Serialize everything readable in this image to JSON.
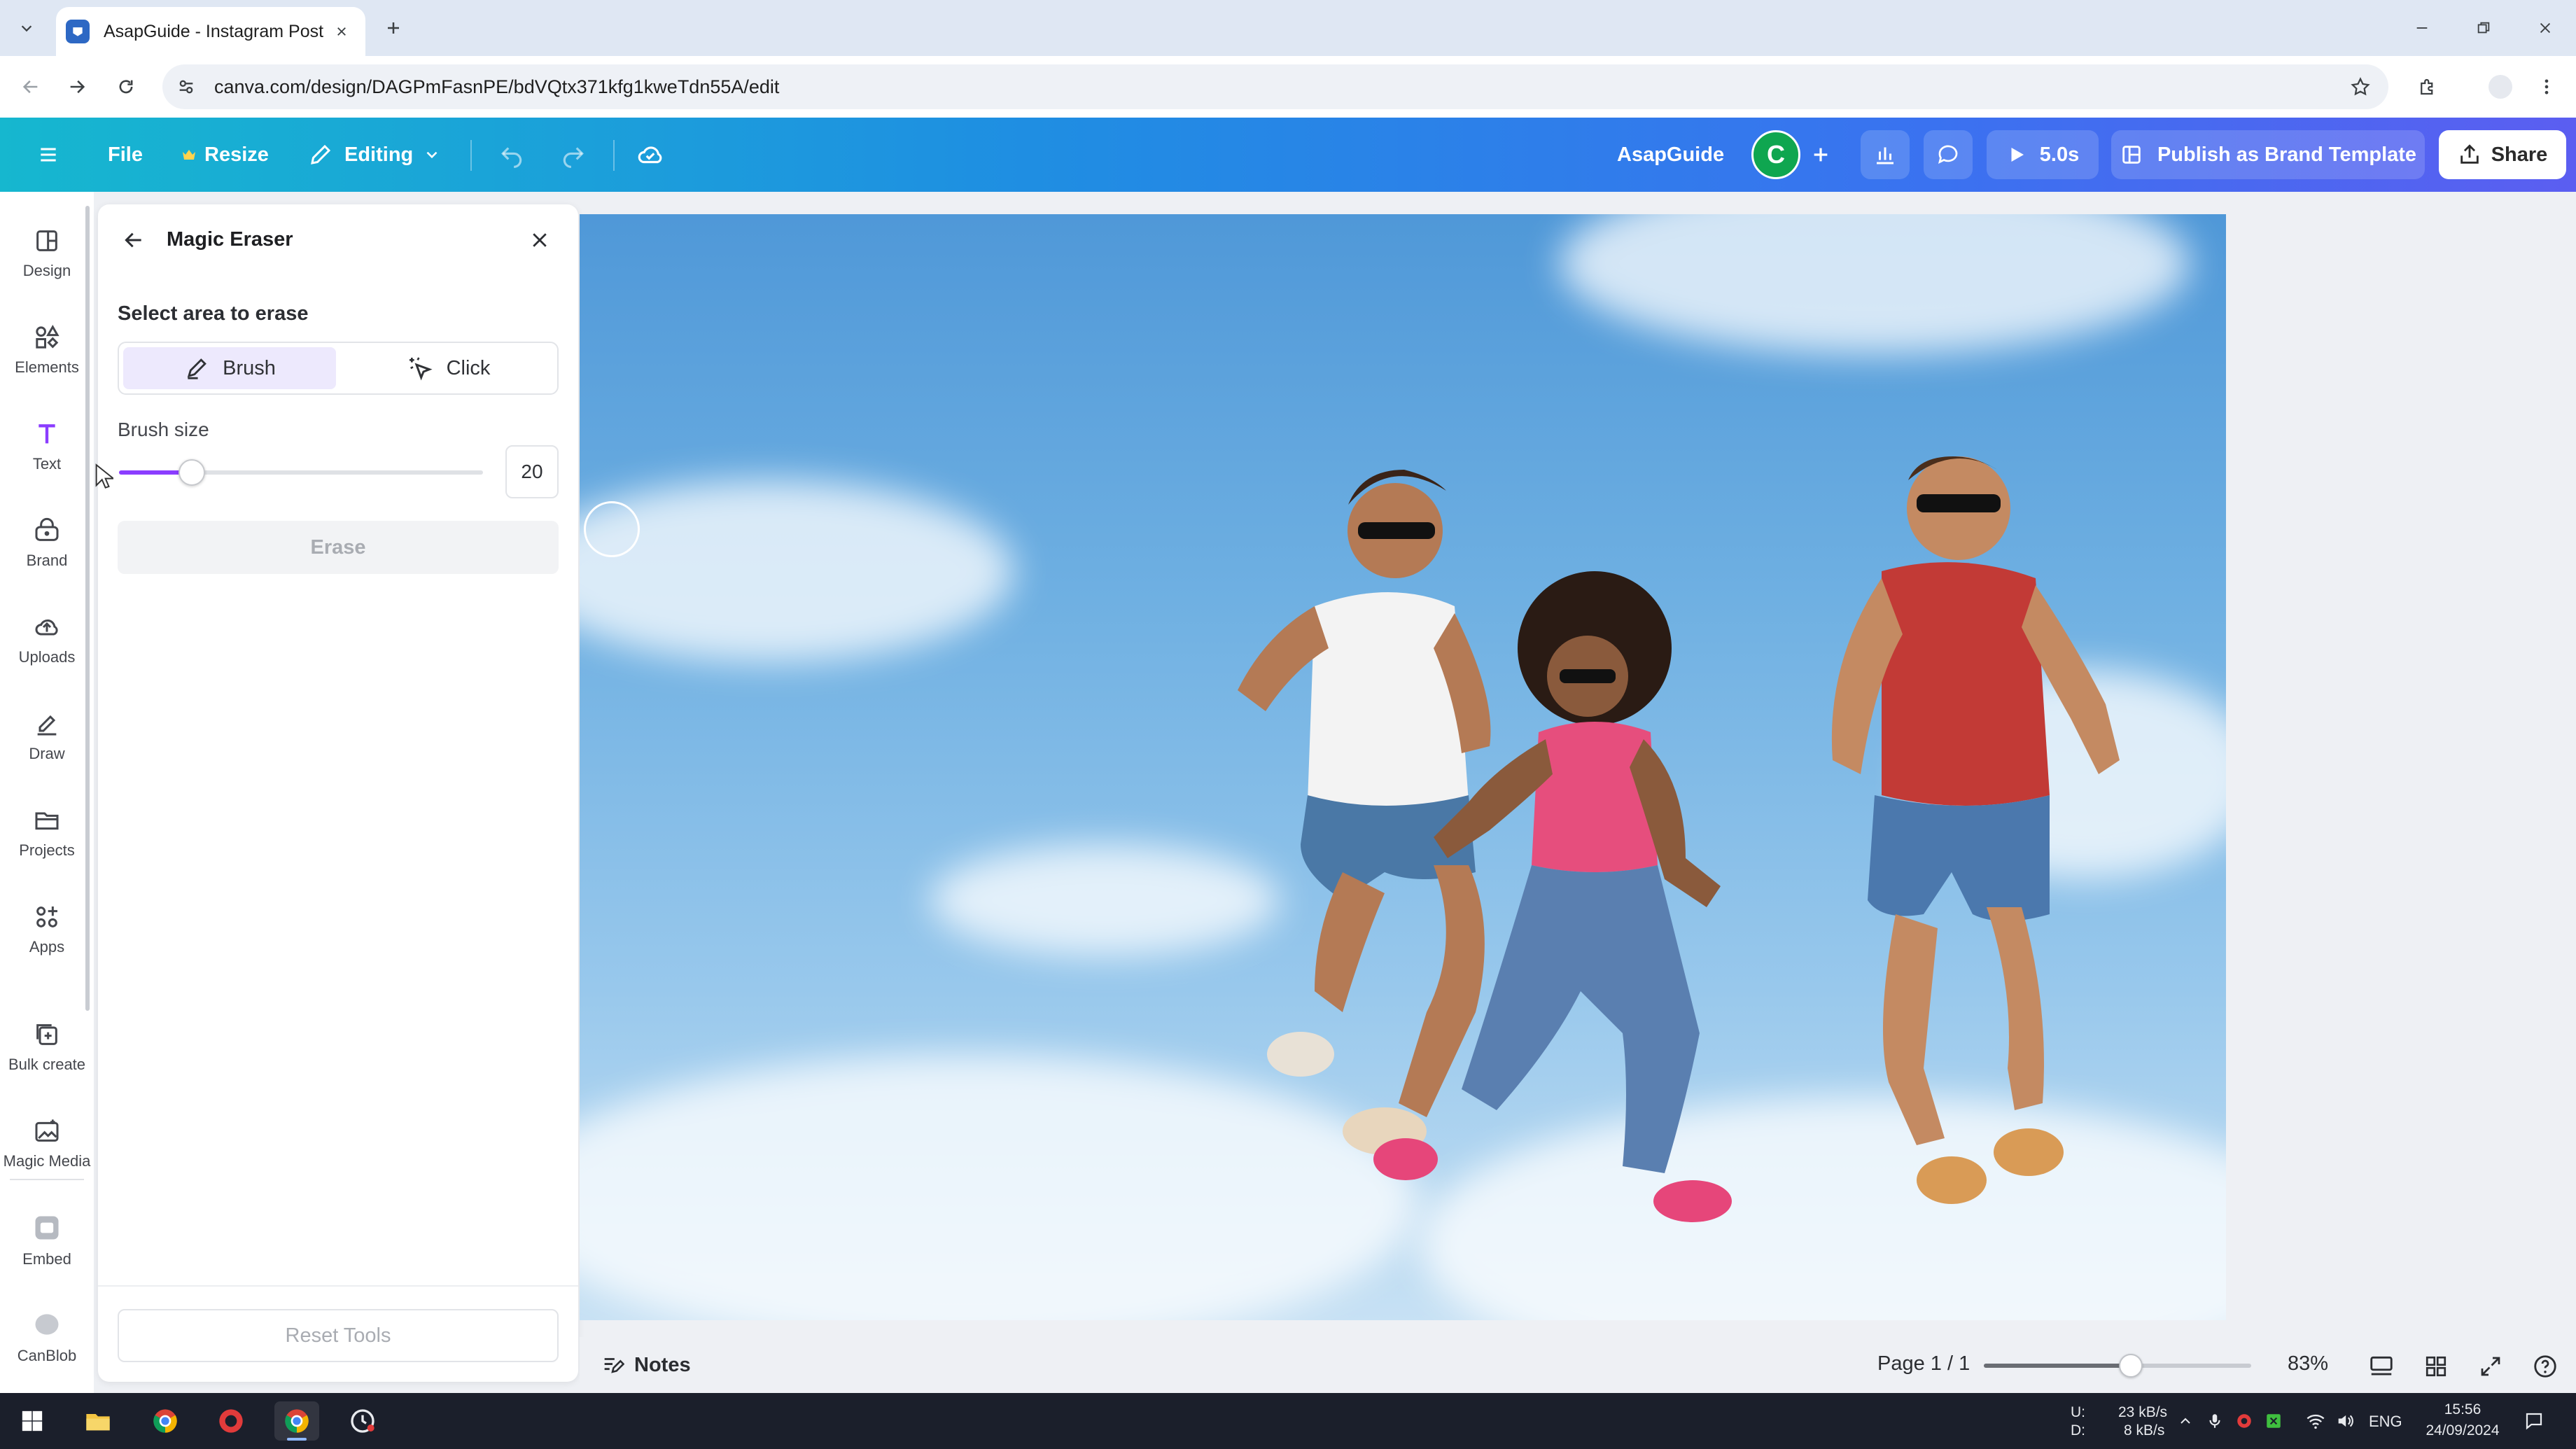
{
  "browser": {
    "tab_title": "AsapGuide - Instagram Post",
    "url": "canva.com/design/DAGPmFasnPE/bdVQtx371kfg1kweTdn55A/edit"
  },
  "header": {
    "file_label": "File",
    "resize_label": "Resize",
    "editing_label": "Editing",
    "team_name": "AsapGuide",
    "avatar_initial": "C",
    "duration_label": "5.0s",
    "publish_label": "Publish as Brand Template",
    "share_label": "Share",
    "accent_color": "#8b3dff"
  },
  "rail": {
    "items": [
      {
        "label": "Design",
        "icon": "design-icon"
      },
      {
        "label": "Elements",
        "icon": "elements-icon"
      },
      {
        "label": "Text",
        "icon": "text-icon"
      },
      {
        "label": "Brand",
        "icon": "brand-icon"
      },
      {
        "label": "Uploads",
        "icon": "uploads-icon"
      },
      {
        "label": "Draw",
        "icon": "draw-icon"
      },
      {
        "label": "Projects",
        "icon": "projects-icon"
      },
      {
        "label": "Apps",
        "icon": "apps-icon"
      },
      {
        "label": "Bulk create",
        "icon": "bulk-create-icon"
      },
      {
        "label": "Magic Media",
        "icon": "magic-media-icon"
      },
      {
        "label": "Embed",
        "icon": "embed-icon"
      },
      {
        "label": "CanBlob",
        "icon": "canblob-icon"
      }
    ]
  },
  "panel": {
    "title": "Magic Eraser",
    "select_label": "Select area to erase",
    "mode_brush": "Brush",
    "mode_click": "Click",
    "selected_mode": "Brush",
    "brush_size_label": "Brush size",
    "brush_size_value": "20",
    "brush_size_fraction": 0.2,
    "erase_label": "Erase",
    "reset_label": "Reset Tools"
  },
  "footer": {
    "notes_label": "Notes",
    "page_indicator": "Page 1 / 1",
    "zoom_label": "83%",
    "zoom_fraction": 0.55
  },
  "taskbar": {
    "net_up_label": "U:",
    "net_down_label": "D:",
    "net_up_value": "23 kB/s",
    "net_down_value": "8 kB/s",
    "language": "ENG",
    "time": "15:56",
    "date": "24/09/2024"
  }
}
